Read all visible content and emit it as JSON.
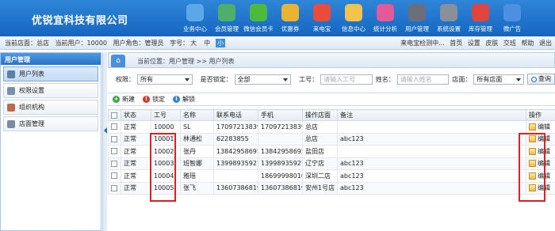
{
  "header": {
    "company": "优锐宜科技有限公司",
    "nav": [
      {
        "label": "业务中心",
        "icon": "monitor-icon",
        "color": "#5aa7ea"
      },
      {
        "label": "会员管理",
        "icon": "member-bars-icon",
        "color": "#4db06a"
      },
      {
        "label": "微信会员卡",
        "icon": "wechat-icon",
        "color": "#4cbb3c"
      },
      {
        "label": "优惠券",
        "icon": "coupon-icon",
        "color": "#e9b431"
      },
      {
        "label": "来电宝",
        "icon": "phone-icon",
        "color": "#e94b3c"
      },
      {
        "label": "信息中心",
        "icon": "mail-icon",
        "color": "#f2c34a"
      },
      {
        "label": "统计分析",
        "icon": "chart-icon",
        "color": "#e35a9b"
      },
      {
        "label": "用户管理",
        "icon": "user-icon",
        "color": "#6a6f7a"
      },
      {
        "label": "系统设置",
        "icon": "tools-icon",
        "color": "#8a8f99"
      },
      {
        "label": "库存管理",
        "icon": "inventory-icon",
        "color": "#e0443d"
      },
      {
        "label": "微广告",
        "icon": "ads-icon",
        "color": "#4d8fe0"
      }
    ]
  },
  "infobar": {
    "store": "当前店面：总店",
    "user": "当前用户：10000",
    "role": "用户角色：管理员",
    "font_label": "字号：",
    "font_sizes": [
      "大",
      "中",
      "小"
    ],
    "right": [
      "来电宝检测中...",
      "首页",
      "设置",
      "皮肤",
      "交班",
      "帮助",
      "退出"
    ]
  },
  "sidebar": {
    "title": "用户管理",
    "items": [
      {
        "label": "用户列表",
        "icon": "user-list-icon"
      },
      {
        "label": "权限设置",
        "icon": "permission-icon"
      },
      {
        "label": "组织机构",
        "icon": "organization-icon"
      },
      {
        "label": "店面管理",
        "icon": "store-icon"
      }
    ]
  },
  "main": {
    "breadcrumb": "当前位置：用户管理 >> 用户列表",
    "search": {
      "role_label": "权限：",
      "role_value": "所有",
      "locked_label": "是否锁定：",
      "locked_value": "全部",
      "empno_label": "工号：",
      "empno_placeholder": "请输入工号",
      "name_label": "姓名：",
      "name_placeholder": "请输入姓名",
      "store_label": "店面：",
      "store_value": "所有店面",
      "query_label": "查询"
    },
    "toolbar": {
      "add": "新建",
      "lock": "锁定",
      "unlock": "解锁"
    },
    "table": {
      "headers": [
        "",
        "状态",
        "工号",
        "名称",
        "联系电话",
        "手机",
        "操作店面",
        "备注",
        "操作"
      ],
      "rows": [
        {
          "status": "正常",
          "id": "10000",
          "name": "SL",
          "phone": "17097213839",
          "mobile": "17097213839",
          "store": "总店",
          "note": "",
          "action": "编辑"
        },
        {
          "status": "正常",
          "id": "10001",
          "name": "林通松",
          "phone": "62283855",
          "mobile": "",
          "store": "总店",
          "note": "abc123",
          "action": "编辑"
        },
        {
          "status": "正常",
          "id": "10002",
          "name": "张丹",
          "phone": "13842958695",
          "mobile": "13842958695",
          "store": "盐田店",
          "note": "",
          "action": "编辑"
        },
        {
          "status": "正常",
          "id": "10003",
          "name": "班智娜",
          "phone": "13998935927",
          "mobile": "13998935927",
          "store": "辽宁店",
          "note": "abc123",
          "action": "编辑"
        },
        {
          "status": "正常",
          "id": "10004",
          "name": "雅瑶",
          "phone": "",
          "mobile": "18699998010",
          "store": "深圳二店",
          "note": "abc123",
          "action": "编辑"
        },
        {
          "status": "正常",
          "id": "10005",
          "name": "张飞",
          "phone": "13607386819",
          "mobile": "13607386819",
          "store": "安州1号店",
          "note": "abc123",
          "action": "编辑"
        }
      ]
    }
  },
  "colors": {
    "header_blue": "#1f73cc",
    "highlight_red": "#e02020",
    "accent": "#3b8ee0"
  }
}
